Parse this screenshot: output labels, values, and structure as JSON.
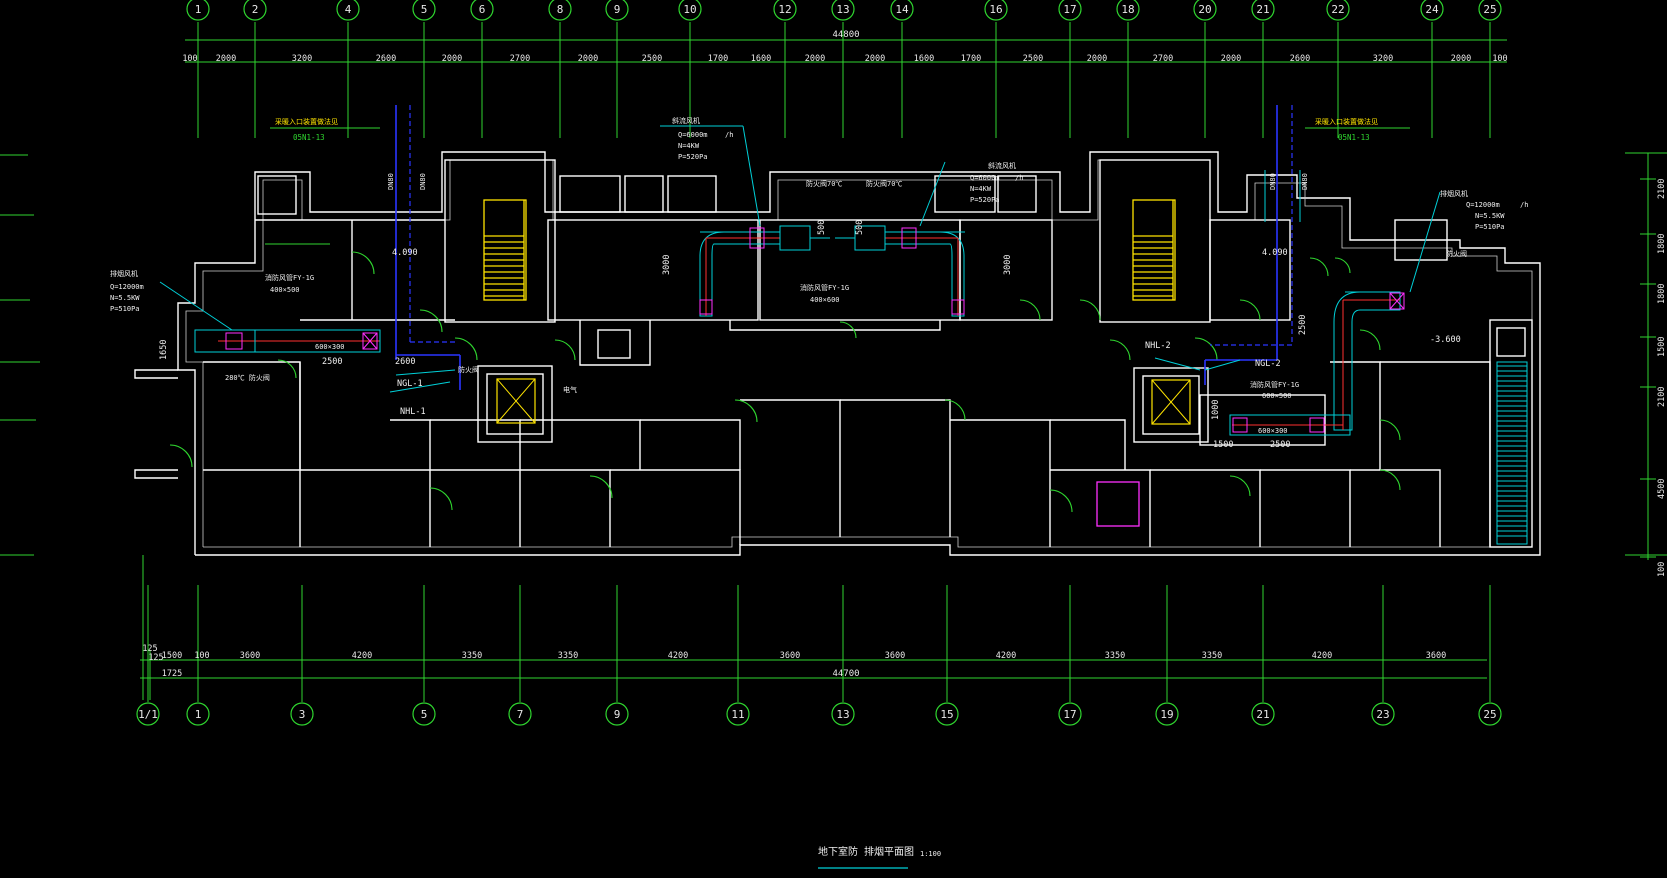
{
  "drawing": {
    "title": "地下室防 排烟平面图",
    "scale": "1:100"
  },
  "colors": {
    "background": "#000000",
    "grid": "#2fd52f",
    "wall": "#ffffff",
    "duct": "#ff3030",
    "leader": "#00d0d8",
    "pipe": "#2b35ff",
    "stair": "#ffe400",
    "fan": "#ff30ff"
  },
  "top_axes": [
    "1",
    "2",
    "4",
    "5",
    "6",
    "8",
    "9",
    "10",
    "12",
    "13",
    "14",
    "16",
    "17",
    "18",
    "20",
    "21",
    "22",
    "24",
    "25"
  ],
  "top_dims": {
    "total": "44800",
    "segments": [
      "100",
      "2000",
      "3200",
      "2600",
      "2000",
      "2700",
      "2000",
      "2500",
      "1700",
      "1600",
      "2000",
      "2000",
      "1600",
      "1700",
      "2500",
      "2000",
      "2700",
      "2000",
      "2600",
      "3200",
      "2000",
      "100"
    ]
  },
  "bottom_axes": [
    "1/1",
    "1",
    "3",
    "5",
    "7",
    "9",
    "11",
    "13",
    "15",
    "17",
    "19",
    "21",
    "23",
    "25"
  ],
  "bottom_dims": {
    "total": "44700",
    "segments": [
      "125",
      "1500",
      "100",
      "3600",
      "4200",
      "3350",
      "3350",
      "4200",
      "3600",
      "3600",
      "4200",
      "3350",
      "3350",
      "4200",
      "3600"
    ],
    "extra_125": "125",
    "extra_1725": "1725"
  },
  "right_dims": [
    "2100",
    "1800",
    "1800",
    "1500",
    "2100",
    "4500",
    "100"
  ],
  "labels": {
    "fresh_air_entry_left": "采暖入口装置做法见",
    "fresh_air_ref_left": "05N1-13",
    "fresh_air_entry_right": "采暖入口装置做法见",
    "fresh_air_ref_right": "05N1-13",
    "dn_a": "DN80",
    "dn_b": "DN80",
    "dn_c": "DN80",
    "dn_d": "DN80",
    "fan_left_title": "排烟风机",
    "fan_left_q": "Q=12000m",
    "fan_left_n": "N=5.5KW",
    "fan_left_p": "P=510Pa",
    "fan_right_title": "排烟风机",
    "fan_right_q": "Q=12000m",
    "fan_right_n": "N=5.5KW",
    "fan_right_p": "P=510Pa",
    "sfan_left_title": "斜流风机",
    "sfan_left_q": "Q=6000m",
    "sfan_left_n": "N=4KW",
    "sfan_left_p": "P=520Pa",
    "sfan_right_title": "斜流风机",
    "sfan_right_q": "Q=6000m",
    "sfan_right_n": "N=4KW",
    "sfan_right_p": "P=520Pa",
    "unit_h": "/h",
    "ngl1": "NGL-1",
    "nhl1": "NHL-1",
    "ngl2": "NGL-2",
    "nhl2": "NHL-2",
    "duct_400_500": "400×500",
    "duct_600_300_l": "600×300",
    "duct_600_300_r": "600×300",
    "duct_400_600": "400×600",
    "duct_600_500": "600×500",
    "dim_2500_l": "2500",
    "dim_2600_l": "2600",
    "dim_2500_r": "2500",
    "dim_1500_r": "1500",
    "dim_1000_r": "1000",
    "dim_1650": "1650",
    "dim_3000_l": "3000",
    "dim_3000_r": "3000",
    "dim_500_l": "500",
    "dim_500_r": "500",
    "dim_2500_v": "2500",
    "elev_4090_l": "4.090",
    "elev_4090_r": "4.090",
    "elev_m3600": "-3.600",
    "fire_damper_l": "防火阀",
    "fire_damper_r": "防火阀",
    "smoke_valve_l": "防火阀70℃",
    "smoke_valve_r": "防火阀70℃",
    "smoke_valve_280": "280℃ 防火阀",
    "tag_sf_l": "消防风管FY-1G",
    "tag_sf_mid": "消防风管FY-1G",
    "tag_sf_r": "消防风管FY-1G",
    "tag_elec": "电气"
  }
}
